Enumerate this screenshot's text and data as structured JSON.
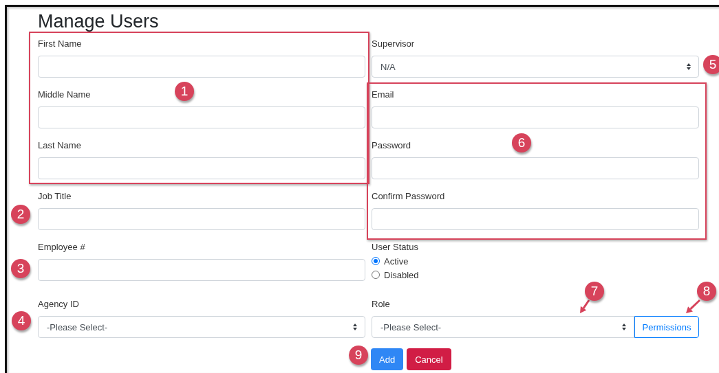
{
  "title": "Manage Users",
  "left_fields": [
    {
      "kind": "text",
      "label": "First Name"
    },
    {
      "kind": "text",
      "label": "Middle Name"
    },
    {
      "kind": "text",
      "label": "Last Name"
    },
    {
      "kind": "text",
      "label": "Job Title"
    },
    {
      "kind": "text",
      "label": "Employee #"
    },
    {
      "kind": "select",
      "label": "Agency ID",
      "value": "-Please Select-"
    }
  ],
  "right_fields": [
    {
      "kind": "select",
      "label": "Supervisor",
      "value": "N/A"
    },
    {
      "kind": "text",
      "label": "Email"
    },
    {
      "kind": "text",
      "label": "Password"
    },
    {
      "kind": "text",
      "label": "Confirm Password"
    },
    {
      "kind": "radio",
      "label": "User Status",
      "options": [
        {
          "label": "Active",
          "selected": true
        },
        {
          "label": "Disabled",
          "selected": false
        }
      ]
    },
    {
      "kind": "select_button",
      "label": "Role",
      "value": "-Please Select-",
      "button": "Permissions"
    }
  ],
  "buttons": [
    {
      "kind": "primary",
      "label": "Add"
    },
    {
      "kind": "danger",
      "label": "Cancel"
    }
  ],
  "callouts": [
    {
      "number": "1"
    },
    {
      "number": "2"
    },
    {
      "number": "3"
    },
    {
      "number": "4"
    },
    {
      "number": "5"
    },
    {
      "number": "6"
    },
    {
      "number": "7",
      "arrow": true
    },
    {
      "number": "8",
      "arrow": true
    },
    {
      "number": "9"
    }
  ]
}
